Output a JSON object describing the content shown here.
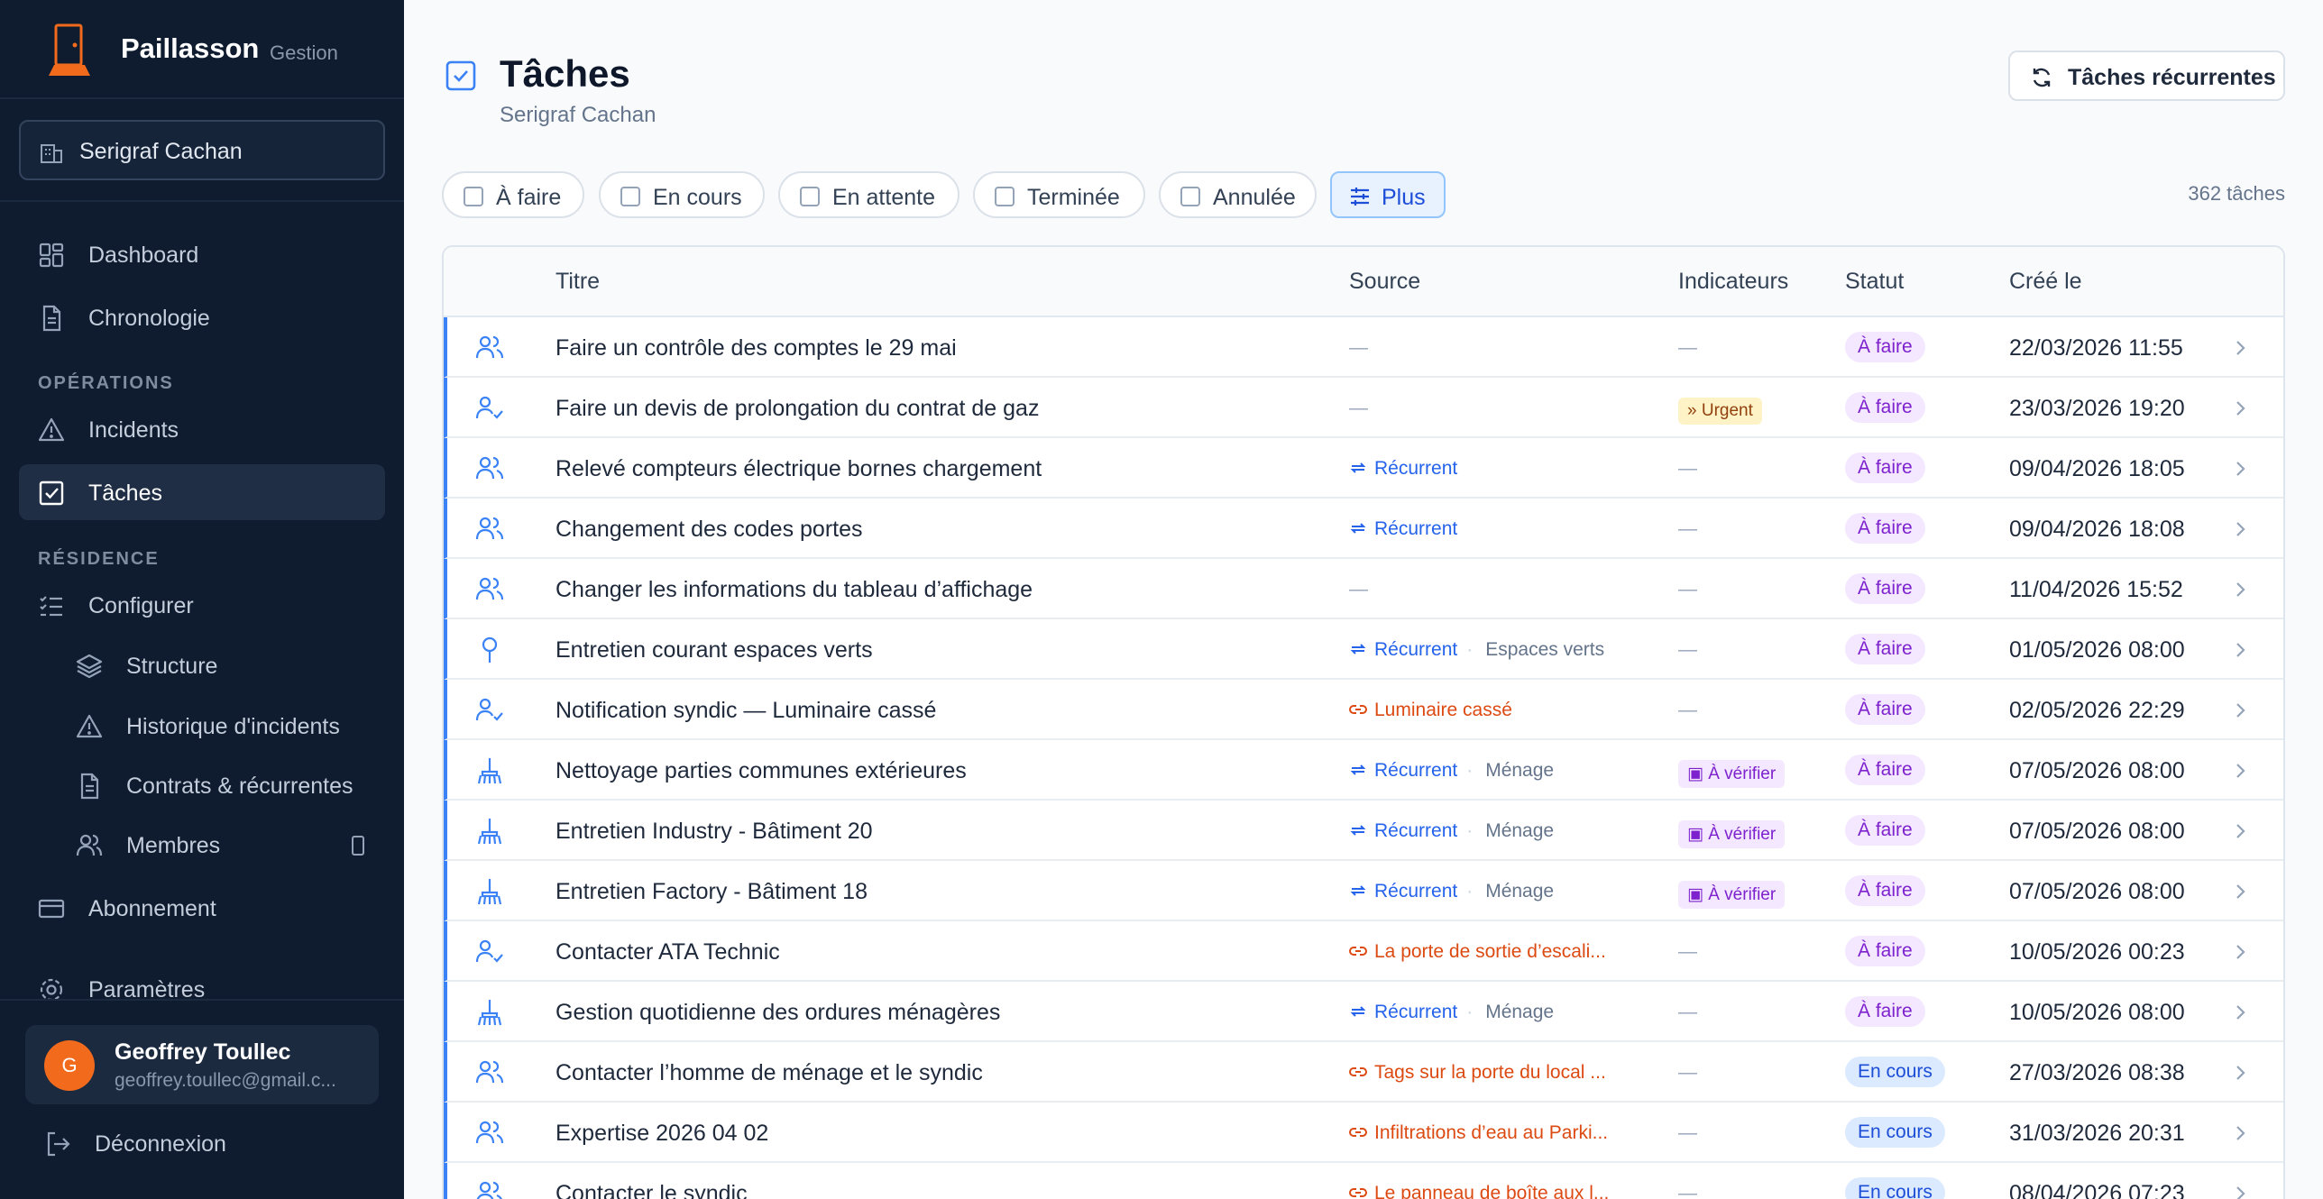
{
  "sidebar": {
    "brand_name": "Paillasson",
    "brand_sub": "Gestion",
    "residence": "Serigraf Cachan",
    "nav_main": [
      {
        "label": "Dashboard",
        "icon": "dashboard-icon"
      },
      {
        "label": "Chronologie",
        "icon": "document-icon"
      }
    ],
    "section_operations": "OPÉRATIONS",
    "nav_operations": [
      {
        "label": "Incidents",
        "icon": "warning-icon"
      },
      {
        "label": "Tâches",
        "icon": "checkbox-icon",
        "active": true
      }
    ],
    "section_residence": "RÉSIDENCE",
    "configure_label": "Configurer",
    "nav_residence": [
      {
        "label": "Structure",
        "icon": "layers-icon"
      },
      {
        "label": "Historique d'incidents",
        "icon": "warning-icon"
      },
      {
        "label": "Contrats & récurrentes",
        "icon": "document-icon"
      },
      {
        "label": "Membres",
        "icon": "users-icon"
      }
    ],
    "subscription_label": "Abonnement",
    "settings_label": "Paramètres",
    "user": {
      "initial": "G",
      "name": "Geoffrey Toullec",
      "email": "geoffrey.toullec@gmail.c..."
    },
    "logout_label": "Déconnexion"
  },
  "header": {
    "title": "Tâches",
    "subtitle": "Serigraf Cachan",
    "recurring_button": "Tâches récurrentes"
  },
  "filters": {
    "chips": [
      "À faire",
      "En cours",
      "En attente",
      "Terminée",
      "Annulée"
    ],
    "more_label": "Plus",
    "count": "362 tâches"
  },
  "table": {
    "columns": [
      "Titre",
      "Source",
      "Indicateurs",
      "Statut",
      "Créé le"
    ],
    "rows": [
      {
        "icon": "users",
        "title": "Faire un contrôle des comptes le 29 mai",
        "source_type": "none",
        "source": "—",
        "category": "",
        "indicator_type": "none",
        "indicator": "—",
        "status": "À faire",
        "status_type": "todo",
        "created": "22/03/2026 11:55"
      },
      {
        "icon": "user-check",
        "title": "Faire un devis de prolongation du contrat de gaz",
        "source_type": "none",
        "source": "—",
        "category": "",
        "indicator_type": "urgent",
        "indicator": "Urgent",
        "status": "À faire",
        "status_type": "todo",
        "created": "23/03/2026 19:20"
      },
      {
        "icon": "users",
        "title": "Relevé compteurs électrique bornes chargement",
        "source_type": "recurring",
        "source": "Récurrent",
        "category": "",
        "indicator_type": "none",
        "indicator": "—",
        "status": "À faire",
        "status_type": "todo",
        "created": "09/04/2026 18:05"
      },
      {
        "icon": "users",
        "title": "Changement des codes portes",
        "source_type": "recurring",
        "source": "Récurrent",
        "category": "",
        "indicator_type": "none",
        "indicator": "—",
        "status": "À faire",
        "status_type": "todo",
        "created": "09/04/2026 18:08"
      },
      {
        "icon": "users",
        "title": "Changer les informations du tableau d’affichage",
        "source_type": "none",
        "source": "—",
        "category": "",
        "indicator_type": "none",
        "indicator": "—",
        "status": "À faire",
        "status_type": "todo",
        "created": "11/04/2026 15:52"
      },
      {
        "icon": "pin",
        "title": "Entretien courant espaces verts",
        "source_type": "recurring",
        "source": "Récurrent",
        "category": "Espaces verts",
        "indicator_type": "none",
        "indicator": "—",
        "status": "À faire",
        "status_type": "todo",
        "created": "01/05/2026 08:00"
      },
      {
        "icon": "user-check",
        "title": "Notification syndic — Luminaire cassé",
        "source_type": "link",
        "source": "Luminaire cassé",
        "category": "",
        "indicator_type": "none",
        "indicator": "—",
        "status": "À faire",
        "status_type": "todo",
        "created": "02/05/2026 22:29"
      },
      {
        "icon": "broom",
        "title": "Nettoyage parties communes extérieures",
        "source_type": "recurring",
        "source": "Récurrent",
        "category": "Ménage",
        "indicator_type": "verify",
        "indicator": "À vérifier",
        "status": "À faire",
        "status_type": "todo",
        "created": "07/05/2026 08:00"
      },
      {
        "icon": "broom",
        "title": "Entretien Industry - Bâtiment 20",
        "source_type": "recurring",
        "source": "Récurrent",
        "category": "Ménage",
        "indicator_type": "verify",
        "indicator": "À vérifier",
        "status": "À faire",
        "status_type": "todo",
        "created": "07/05/2026 08:00"
      },
      {
        "icon": "broom",
        "title": "Entretien Factory - Bâtiment 18",
        "source_type": "recurring",
        "source": "Récurrent",
        "category": "Ménage",
        "indicator_type": "verify",
        "indicator": "À vérifier",
        "status": "À faire",
        "status_type": "todo",
        "created": "07/05/2026 08:00"
      },
      {
        "icon": "user-check",
        "title": "Contacter ATA Technic",
        "source_type": "link",
        "source": "La porte de sortie d’escali...",
        "category": "",
        "indicator_type": "none",
        "indicator": "—",
        "status": "À faire",
        "status_type": "todo",
        "created": "10/05/2026 00:23"
      },
      {
        "icon": "broom",
        "title": "Gestion quotidienne des ordures ménagères",
        "source_type": "recurring",
        "source": "Récurrent",
        "category": "Ménage",
        "indicator_type": "none",
        "indicator": "—",
        "status": "À faire",
        "status_type": "todo",
        "created": "10/05/2026 08:00"
      },
      {
        "icon": "users",
        "title": "Contacter l’homme de ménage et le syndic",
        "source_type": "link",
        "source": "Tags sur la porte du local ...",
        "category": "",
        "indicator_type": "none",
        "indicator": "—",
        "status": "En cours",
        "status_type": "wip",
        "created": "27/03/2026 08:38"
      },
      {
        "icon": "users",
        "title": "Expertise 2026 04 02",
        "source_type": "link",
        "source": "Infiltrations d’eau au Parki...",
        "category": "",
        "indicator_type": "none",
        "indicator": "—",
        "status": "En cours",
        "status_type": "wip",
        "created": "31/03/2026 20:31"
      },
      {
        "icon": "users",
        "title": "Contacter le syndic",
        "source_type": "link",
        "source": "Le panneau de boîte aux l...",
        "category": "",
        "indicator_type": "none",
        "indicator": "—",
        "status": "En cours",
        "status_type": "wip",
        "created": "08/04/2026 07:23"
      }
    ]
  },
  "colors": {
    "sidebar_bg": "#0f1b2e",
    "accent": "#3b82f6",
    "todo": "#7e22ce",
    "wip": "#1d4ed8",
    "link": "#dc4a12",
    "urgent_bg": "#fef3c7"
  }
}
